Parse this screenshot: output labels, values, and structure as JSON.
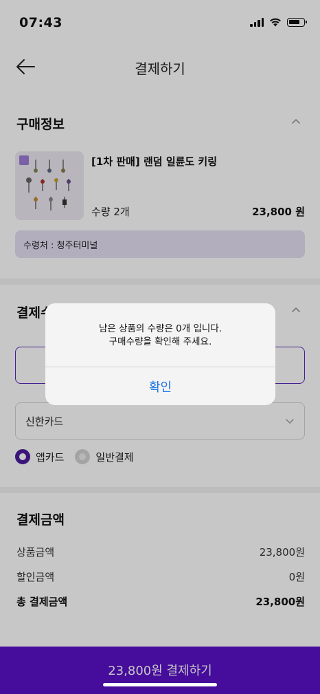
{
  "status_bar": {
    "time": "07:43"
  },
  "header": {
    "title": "결제하기"
  },
  "purchase_info": {
    "title": "구매정보",
    "product_name": "[1차 판매] 랜덤 일륜도 키링",
    "quantity": "수량 2개",
    "price": "23,800 원",
    "pickup": "수령처 : 청주터미널"
  },
  "payment_method": {
    "title": "결제수단",
    "card_select": "신한카드",
    "options": [
      "앱카드",
      "일반결제"
    ],
    "selected_option": "앱카드"
  },
  "payment_amount": {
    "title": "결제금액",
    "rows": [
      {
        "label": "상품금액",
        "value": "23,800원"
      },
      {
        "label": "할인금액",
        "value": "0원"
      },
      {
        "label": "총 결제금액",
        "value": "23,800원"
      }
    ]
  },
  "pay_button": {
    "label": "23,800원 결제하기"
  },
  "alert": {
    "message_line1": "남은 상품의 수량은 0개 입니다.",
    "message_line2": "구매수량을 확인해 주세요.",
    "confirm": "확인"
  },
  "colors": {
    "brand": "#5a10c8",
    "radio_selected": "#4b1d9e",
    "pickup_bg": "#e6dff3",
    "alert_button": "#1a73e8"
  }
}
